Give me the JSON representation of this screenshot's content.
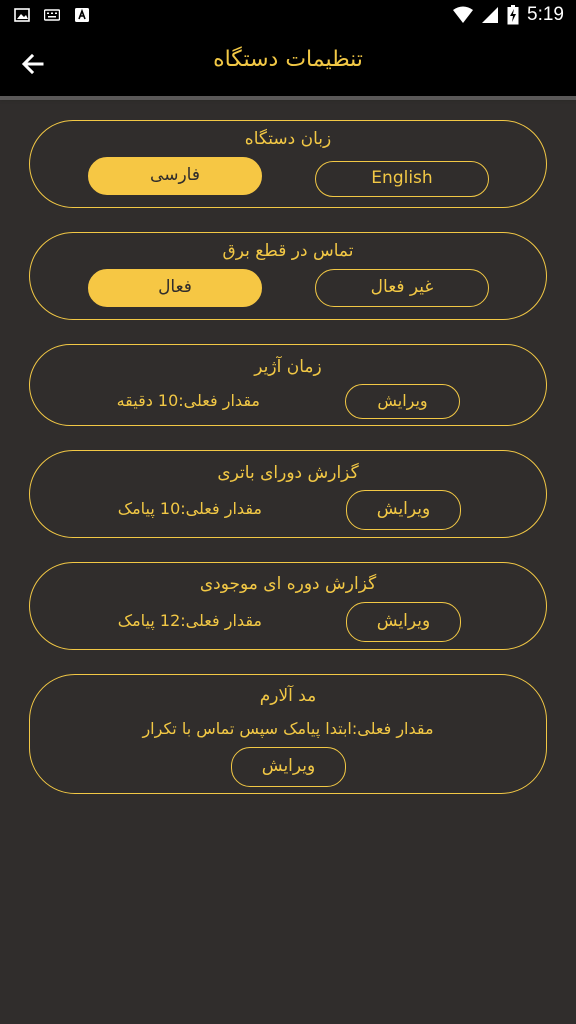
{
  "status_bar": {
    "icons": [
      "image-icon",
      "keyboard-icon",
      "accessibility-a-icon"
    ],
    "right_icons": [
      "wifi-icon",
      "signal-icon",
      "battery-charging-icon"
    ],
    "time": "5:19"
  },
  "app_bar": {
    "title": "تنظیمات دستگاه",
    "back_icon": "arrow-left-icon"
  },
  "settings": {
    "language": {
      "title": "زبان دستگاه",
      "option_persian": "فارسی",
      "option_english": "English",
      "selected": "فارسی"
    },
    "power_outage_call": {
      "title": "تماس در قطع برق",
      "option_active": "فعال",
      "option_inactive": "غیر فعال",
      "selected": "فعال"
    },
    "siren_time": {
      "title": "زمان آژیر",
      "current_value": "مقدار فعلی:10 دقیقه",
      "edit_label": "ویرایش"
    },
    "battery_report": {
      "title": "گزارش دورای باتری",
      "current_value": "مقدار فعلی:10 پیامک",
      "edit_label": "ویرایش"
    },
    "balance_report": {
      "title": "گزارش دوره ای موجودی",
      "current_value": "مقدار فعلی:12 پیامک",
      "edit_label": "ویرایش"
    },
    "alarm_mode": {
      "title": "مد آلارم",
      "current_value": "مقدار فعلی:ابتدا پیامک سپس تماس با تکرار",
      "edit_label": "ویرایش"
    }
  },
  "colors": {
    "background": "#302d2c",
    "accent": "#f2c845",
    "selected_fill": "#f6c744",
    "bar": "#000000"
  }
}
